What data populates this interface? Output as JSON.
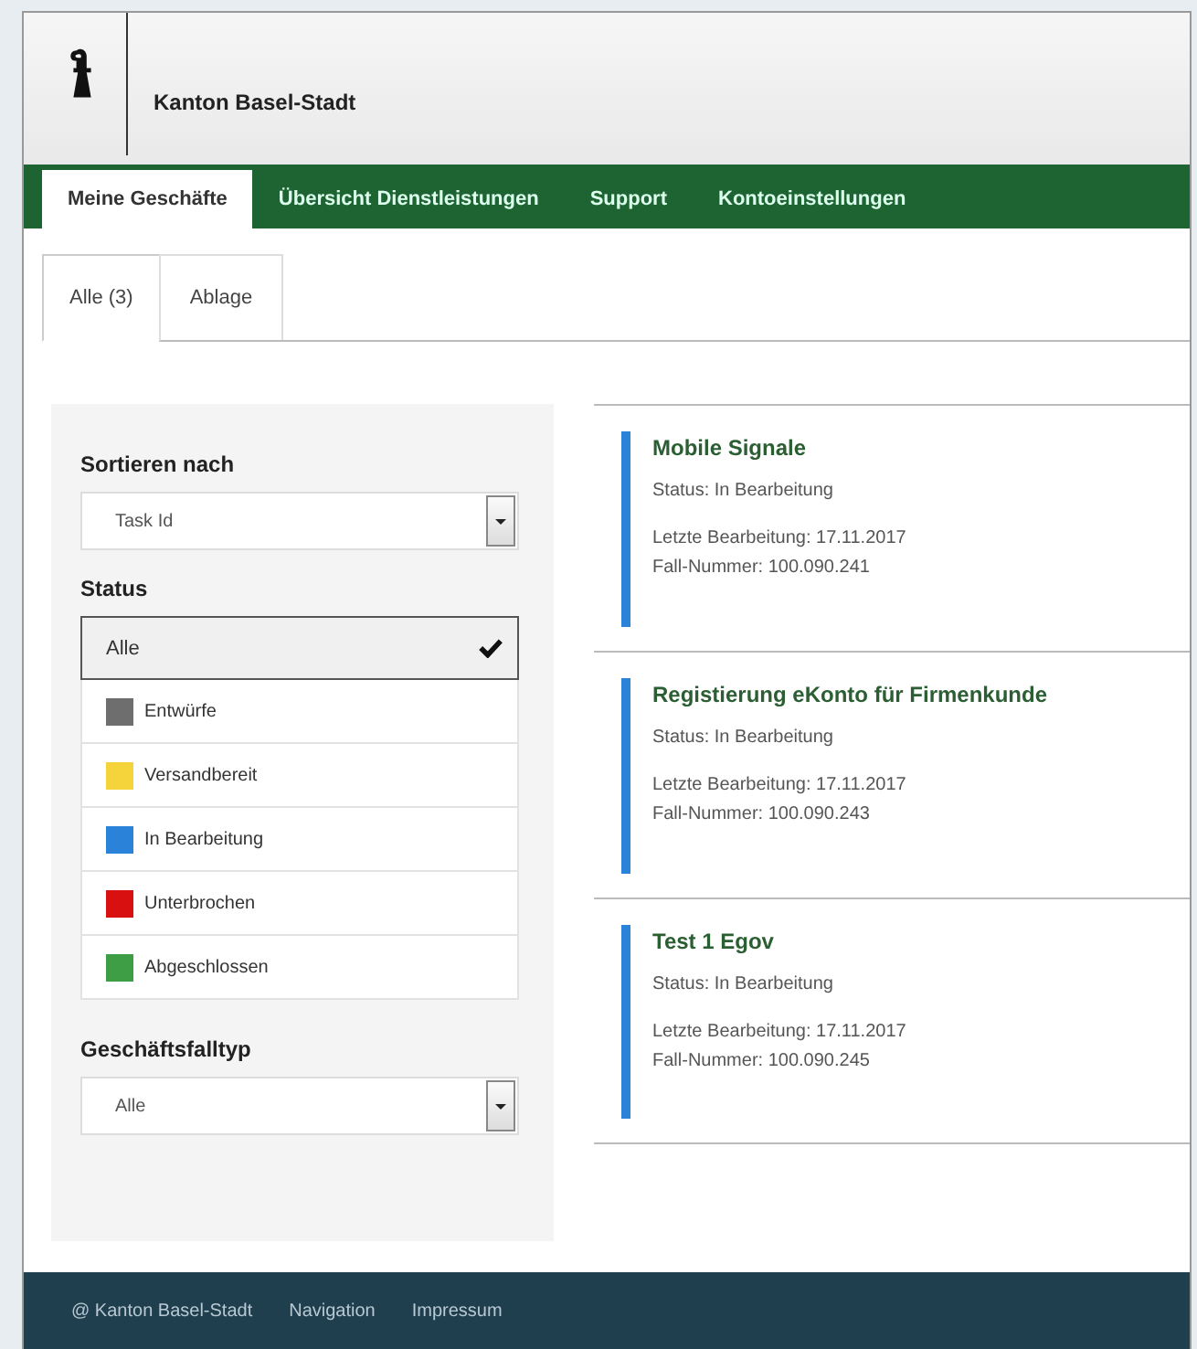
{
  "header": {
    "title": "Kanton Basel-Stadt"
  },
  "nav": [
    {
      "label": "Meine Geschäfte",
      "selected": true
    },
    {
      "label": "Übersicht Dienstleistungen",
      "selected": false
    },
    {
      "label": "Support",
      "selected": false
    },
    {
      "label": "Kontoeinstellungen",
      "selected": false
    }
  ],
  "subtabs": [
    {
      "label": "Alle (3)",
      "selected": true
    },
    {
      "label": "Ablage",
      "selected": false
    }
  ],
  "sidebar": {
    "sort_label": "Sortieren nach",
    "sort_value": "Task Id",
    "status_label": "Status",
    "status_items": [
      {
        "label": "Alle",
        "selected": true
      },
      {
        "label": "Entwürfe",
        "selected": false,
        "color": "#6e6e6e"
      },
      {
        "label": "Versandbereit",
        "selected": false,
        "color": "#f5d33a"
      },
      {
        "label": "In Bearbeitung",
        "selected": false,
        "color": "#2b82d9"
      },
      {
        "label": "Unterbrochen",
        "selected": false,
        "color": "#d81010"
      },
      {
        "label": "Abgeschlossen",
        "selected": false,
        "color": "#3e9e45"
      }
    ],
    "type_label": "Geschäftsfalltyp",
    "type_value": "Alle"
  },
  "cases": [
    {
      "title": "Mobile Signale",
      "status": "Status: In Bearbeitung",
      "last_edit": "Letzte Bearbeitung: 17.11.2017",
      "number": "Fall-Nummer: 100.090.241",
      "color": "#2b82d9"
    },
    {
      "title": "Registierung eKonto für Firmenkunde",
      "status": "Status: In Bearbeitung",
      "last_edit": "Letzte Bearbeitung: 17.11.2017",
      "number": "Fall-Nummer: 100.090.243",
      "color": "#2b82d9"
    },
    {
      "title": "Test 1 Egov",
      "status": "Status: In Bearbeitung",
      "last_edit": "Letzte Bearbeitung: 17.11.2017",
      "number": "Fall-Nummer: 100.090.245",
      "color": "#2b82d9"
    }
  ],
  "footer": [
    "@ Kanton Basel-Stadt",
    "Navigation",
    "Impressum"
  ]
}
